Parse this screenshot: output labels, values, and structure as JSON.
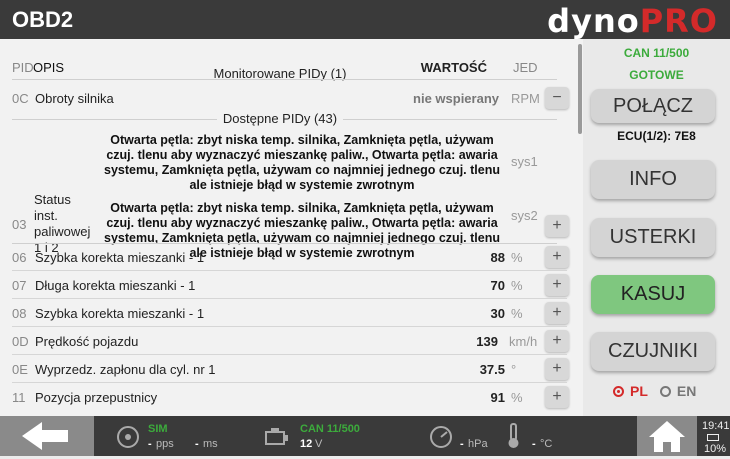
{
  "header": {
    "title": "OBD2",
    "logo_dyno": "dyno",
    "logo_pro": "PRO"
  },
  "table": {
    "col_pid": "PID",
    "col_desc": "OPIS",
    "col_value": "WARTOŚĆ",
    "col_unit": "JED",
    "monitored_title": "Monitorowane PIDy (1)",
    "available_title": "Dostępne PIDy (43)",
    "monitored": [
      {
        "pid": "0C",
        "name": "Obroty silnika",
        "value": "nie wspierany",
        "unit": "RPM",
        "btn": "−"
      }
    ],
    "status_row": {
      "pid": "03",
      "name": "Status inst. paliwowej 1 i 2",
      "sys1_text": "Otwarta pętla: zbyt niska temp. silnika, Zamknięta pętla, używam czuj. tlenu aby wyznaczyć mieszankę paliw., Otwarta pętla: awaria systemu, Zamknięta pętla, używam co najmniej jednego czuj. tlenu ale istnieje błąd w systemie zwrotnym",
      "sys1_label": "sys1",
      "sys2_text": "Otwarta pętla: zbyt niska temp. silnika, Zamknięta pętla, używam czuj. tlenu aby wyznaczyć mieszankę paliw., Otwarta pętla: awaria systemu, Zamknięta pętla, używam co najmniej jednego czuj. tlenu ale istnieje błąd w systemie zwrotnym",
      "sys2_label": "sys2",
      "btn": "+"
    },
    "available": [
      {
        "pid": "06",
        "name": "Szybka korekta mieszanki - 1",
        "value": "88",
        "unit": "%",
        "btn": "+"
      },
      {
        "pid": "07",
        "name": "Długa korekta mieszanki - 1",
        "value": "70",
        "unit": "%",
        "btn": "+"
      },
      {
        "pid": "08",
        "name": "Szybka korekta mieszanki - 1",
        "value": "30",
        "unit": "%",
        "btn": "+"
      },
      {
        "pid": "0D",
        "name": "Prędkość pojazdu",
        "value": "139",
        "unit": "km/h",
        "btn": "+"
      },
      {
        "pid": "0E",
        "name": "Wyprzedz. zapłonu dla cyl. nr 1",
        "value": "37.5",
        "unit": "°",
        "btn": "+"
      },
      {
        "pid": "11",
        "name": "Pozycja przepustnicy",
        "value": "91",
        "unit": "%",
        "btn": "+"
      }
    ]
  },
  "side": {
    "can": "CAN 11/500",
    "ready": "GOTOWE",
    "connect": "POŁĄCZ",
    "ecu": "ECU(1/2): 7E8",
    "info": "INFO",
    "faults": "USTERKI",
    "clear": "KASUJ",
    "sensors": "CZUJNIKI",
    "lang_pl": "PL",
    "lang_en": "EN",
    "colors": {
      "green_button": "#7fc77f",
      "status_green": "#3cab3c",
      "accent_red": "#d42a2a"
    }
  },
  "bottom": {
    "sim": "SIM",
    "pps_val": "-",
    "pps_unit": "pps",
    "ms_val": "-",
    "ms_unit": "ms",
    "can": "CAN 11/500",
    "volt_val": "12",
    "volt_unit": "V",
    "hpa_val": "-",
    "hpa_unit": "hPa",
    "temp_val": "-",
    "temp_unit": "°C",
    "time": "19:41",
    "battery": "10%"
  }
}
